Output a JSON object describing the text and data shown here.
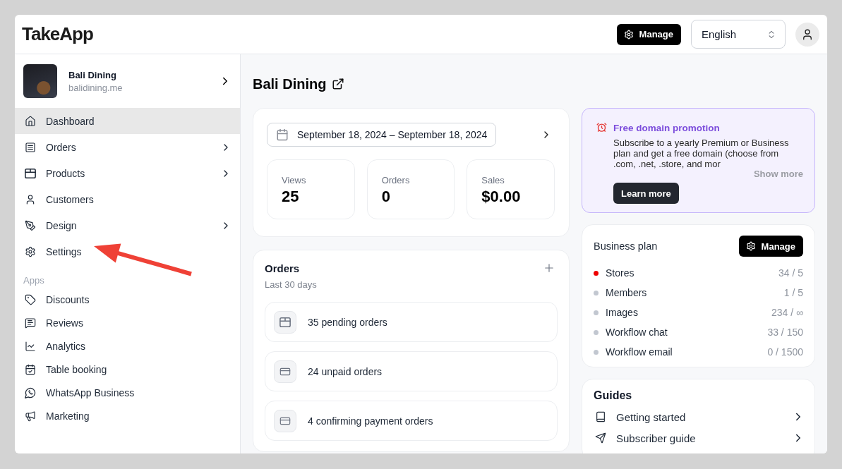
{
  "header": {
    "logo": "TakeApp",
    "manage_button": "Manage",
    "language": "English"
  },
  "sidebar": {
    "store": {
      "name": "Bali Dining",
      "domain": "balidining.me"
    },
    "items": [
      {
        "label": "Dashboard",
        "selected": true,
        "expandable": false
      },
      {
        "label": "Orders",
        "selected": false,
        "expandable": true
      },
      {
        "label": "Products",
        "selected": false,
        "expandable": true
      },
      {
        "label": "Customers",
        "selected": false,
        "expandable": false
      },
      {
        "label": "Design",
        "selected": false,
        "expandable": true
      },
      {
        "label": "Settings",
        "selected": false,
        "expandable": false
      }
    ],
    "apps_heading": "Apps",
    "apps": [
      {
        "label": "Discounts",
        "selected": false
      },
      {
        "label": "Reviews",
        "selected": false
      },
      {
        "label": "Analytics",
        "selected": false
      },
      {
        "label": "Table booking",
        "selected": false
      },
      {
        "label": "WhatsApp Business",
        "selected": false
      },
      {
        "label": "Marketing",
        "selected": false
      }
    ]
  },
  "main": {
    "title": "Bali Dining",
    "date_range": "September 18, 2024 – September 18, 2024",
    "stats": [
      {
        "label": "Views",
        "value": "25"
      },
      {
        "label": "Orders",
        "value": "0"
      },
      {
        "label": "Sales",
        "value": "$0.00"
      }
    ],
    "orders": {
      "title": "Orders",
      "subtitle": "Last 30 days",
      "rows": [
        "35 pending orders",
        "24 unpaid orders",
        "4 confirming payment orders"
      ]
    },
    "promo": {
      "title": "Free domain promotion",
      "body": "Subscribe to a yearly Premium or Business plan and get a free domain (choose from .com, .net, .store, and mor",
      "show_more": "Show more",
      "button": "Learn more"
    },
    "plan": {
      "title": "Business plan",
      "button": "Manage",
      "rows": [
        {
          "label": "Stores",
          "value": "34 / 5",
          "color": "#ee0000"
        },
        {
          "label": "Members",
          "value": "1 / 5",
          "color": "#c2c7d0"
        },
        {
          "label": "Images",
          "value": "234 / ∞",
          "color": "#c2c7d0"
        },
        {
          "label": "Workflow chat",
          "value": "33 / 150",
          "color": "#c2c7d0"
        },
        {
          "label": "Workflow email",
          "value": "0 / 1500",
          "color": "#c2c7d0"
        }
      ]
    },
    "guides": {
      "title": "Guides",
      "items": [
        "Getting started",
        "Subscriber guide"
      ]
    }
  }
}
